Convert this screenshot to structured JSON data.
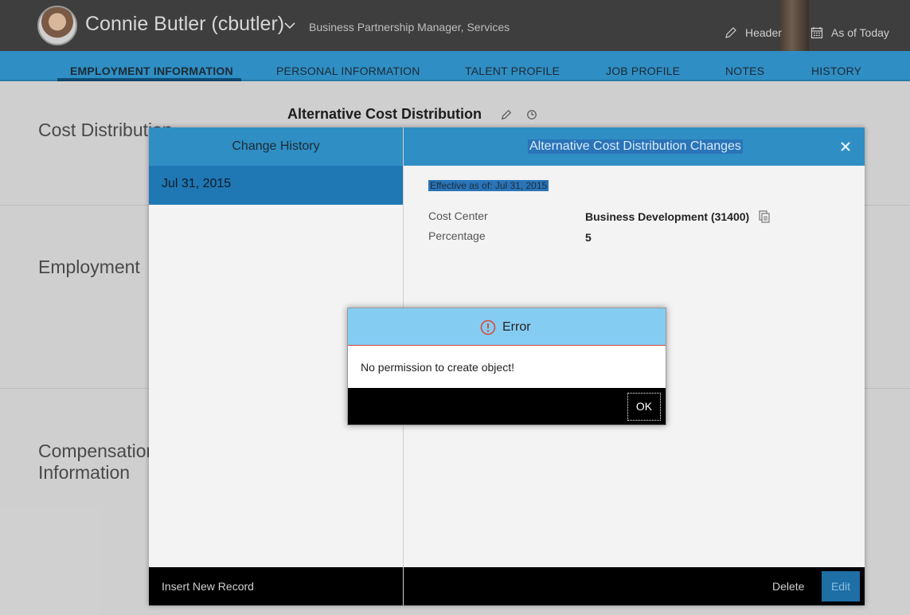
{
  "header": {
    "user_name": "Connie Butler (cbutler)",
    "user_role": "Business Partnership Manager, Services",
    "header_label": "Header",
    "as_of_label": "As of Today"
  },
  "tabs": [
    {
      "label": "EMPLOYMENT INFORMATION",
      "active": true
    },
    {
      "label": "PERSONAL INFORMATION",
      "active": false
    },
    {
      "label": "TALENT PROFILE",
      "active": false
    },
    {
      "label": "JOB PROFILE",
      "active": false
    },
    {
      "label": "NOTES",
      "active": false
    },
    {
      "label": "HISTORY",
      "active": false
    }
  ],
  "background": {
    "sections": [
      "Cost Distribution",
      "Employment",
      "Compensation Information"
    ],
    "alt_title": "Alternative Cost Distribution"
  },
  "history_dialog": {
    "left_title": "Change History",
    "right_title": "Alternative Cost Distribution Changes",
    "records": [
      "Jul 31, 2015"
    ],
    "effective": "Effective as of: Jul 31, 2015",
    "fields": [
      {
        "label": "Cost Center",
        "value": "Business Development (31400)"
      },
      {
        "label": "Percentage",
        "value": "5"
      }
    ],
    "insert_label": "Insert New Record",
    "delete_label": "Delete",
    "edit_label": "Edit"
  },
  "error_dialog": {
    "title": "Error",
    "message": "No permission to create object!",
    "ok_label": "OK"
  },
  "colors": {
    "tab_bar": "#2f8ec4",
    "error_header": "#85ccf2",
    "error_accent": "#d64b3a"
  }
}
